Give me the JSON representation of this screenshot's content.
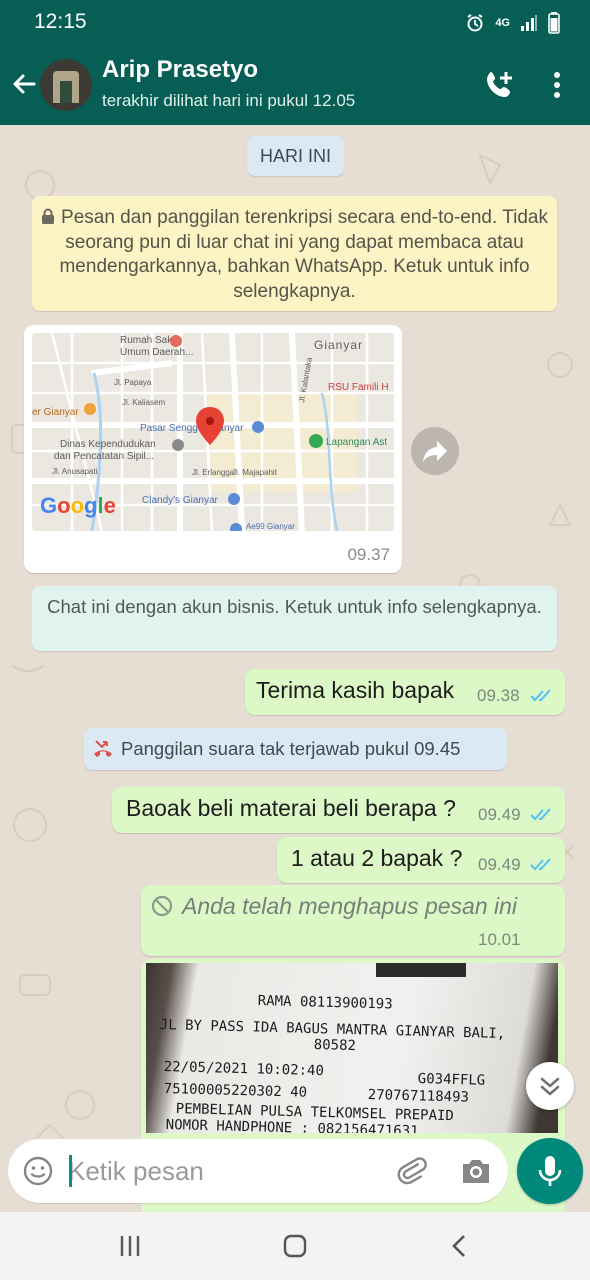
{
  "status_bar": {
    "time": "12:15",
    "network": "4G"
  },
  "header": {
    "name": "Arip Prasetyo",
    "last_seen": "terakhir dilihat hari ini pukul 12.05"
  },
  "chat": {
    "date_chip": "HARI INI",
    "encryption_notice": "Pesan dan panggilan terenkripsi secara end-to-end. Tidak seorang pun di luar chat ini yang dapat membaca atau mendengarkannya, bahkan WhatsApp. Ketuk untuk info selengkapnya.",
    "map_message": {
      "time": "09.37",
      "labels": {
        "hospital": "Rumah Sakit Umum Daerah...",
        "gianyar": "Gianyar",
        "papaya": "Jl. Papaya",
        "rsu_famili": "RSU Famili H",
        "kaliasem": "Jl. Kaliasem",
        "kalantaka": "Jl. Kalantaka",
        "er_gianyar": "er Gianyar",
        "pasar": "Pasar Senggol Gianyar",
        "lapangan": "Lapangan Ast",
        "dinas1": "Dinas Kependudukan",
        "dinas2": "dan Pencatatan Sipil...",
        "anusapati": "Jl. Anusapati",
        "erlangga": "Jl. Erlangga",
        "majapahit": "Jl. Majapahit",
        "clandys": "Clandy's Gianyar",
        "logo": "Google",
        "bottom": "Ae99 Gianyar"
      }
    },
    "business_notice": "Chat ini dengan akun bisnis. Ketuk untuk info selengkapnya.",
    "messages": [
      {
        "text": "Terima kasih bapak",
        "time": "09.38"
      },
      {
        "text": "Baoak beli materai beli berapa ?",
        "time": "09.49"
      },
      {
        "text": "1 atau 2 bapak ?",
        "time": "09.49"
      }
    ],
    "missed_call": "Panggilan suara tak terjawab pukul 09.45",
    "deleted_message": {
      "text": "Anda telah menghapus pesan ini",
      "time": "10.01"
    },
    "receipt_photo": {
      "lines": [
        "RAMA 08113900193",
        "JL BY PASS IDA BAGUS MANTRA GIANYAR BALI,",
        "80582",
        "22/05/2021 10:02:40",
        "G034FFLG",
        "75100005220302 40",
        "270767118493",
        "PEMBELIAN PULSA TELKOMSEL  PREPAID",
        "NOMOR HANDPHONE   : 082156471631"
      ]
    }
  },
  "composer": {
    "placeholder": "Ketik pesan"
  },
  "colors": {
    "header": "#075e54",
    "outgoing_bubble": "#dcf8c6",
    "accent": "#00897b",
    "read_ticks": "#4fc3f7"
  },
  "icons": {
    "back": "arrow-left-icon",
    "call": "add-call-icon",
    "menu": "more-vert-icon",
    "share": "forward-icon",
    "scroll": "double-chevron-down-icon",
    "emoji": "emoji-icon",
    "attach": "paperclip-icon",
    "camera": "camera-icon",
    "mic": "mic-icon"
  }
}
